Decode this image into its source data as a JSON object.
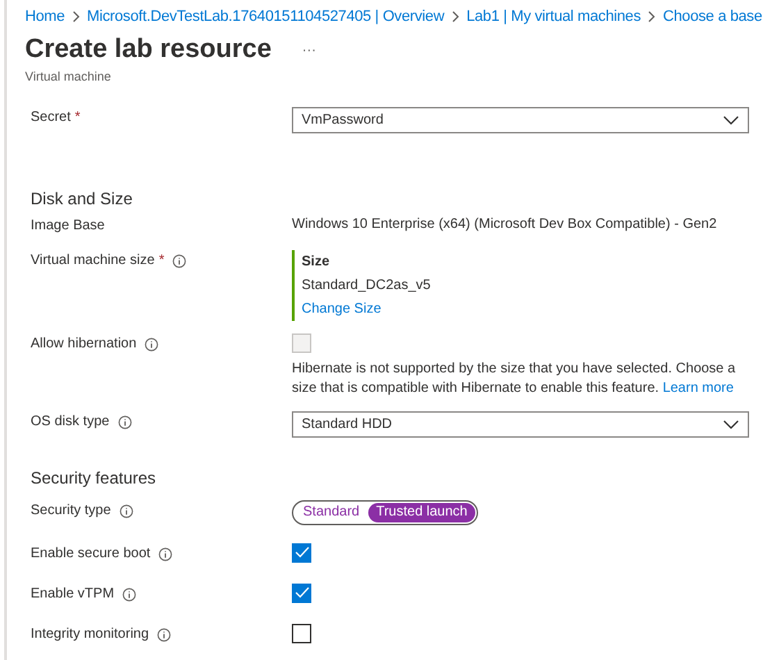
{
  "breadcrumb": [
    "Home",
    "Microsoft.DevTestLab.17640151104527405 | Overview",
    "Lab1 | My virtual machines",
    "Choose a base"
  ],
  "title": "Create lab resource",
  "more": "···",
  "subtitle": "Virtual machine",
  "sections": [
    {
      "rows": [
        {
          "kind": "dropdown",
          "label": "Secret",
          "required_mark": "*",
          "info": false,
          "value": "VmPassword"
        }
      ]
    },
    {
      "heading": "Disk and Size",
      "rows": [
        {
          "kind": "text",
          "label": "Image Base",
          "info": false,
          "value": "Windows 10 Enterprise (x64) (Microsoft Dev Box Compatible) - Gen2"
        },
        {
          "kind": "size",
          "label": "Virtual machine size",
          "required_mark": "*",
          "info": true,
          "size_heading": "Size",
          "value": "Standard_DC2as_v5",
          "link": "Change Size"
        },
        {
          "kind": "checkbox",
          "label": "Allow hibernation",
          "info": true,
          "checked": false,
          "disabled": true,
          "note": "Hibernate is not supported by the size that you have selected. Choose a size that is compatible with Hibernate to enable this feature.",
          "note_link": "Learn more"
        },
        {
          "kind": "dropdown",
          "label": "OS disk type",
          "info": true,
          "value": "Standard HDD"
        }
      ]
    },
    {
      "heading": "Security features",
      "rows": [
        {
          "kind": "toggle",
          "label": "Security type",
          "info": true,
          "options": [
            {
              "label": "Standard",
              "selected": false
            },
            {
              "label": "Trusted launch",
              "selected": true
            }
          ]
        },
        {
          "kind": "checkbox",
          "label": "Enable secure boot",
          "info": true,
          "checked": true,
          "disabled": false
        },
        {
          "kind": "checkbox",
          "label": "Enable vTPM",
          "info": true,
          "checked": true,
          "disabled": false
        },
        {
          "kind": "checkbox",
          "label": "Integrity monitoring",
          "info": true,
          "checked": false,
          "disabled": false
        }
      ]
    }
  ]
}
